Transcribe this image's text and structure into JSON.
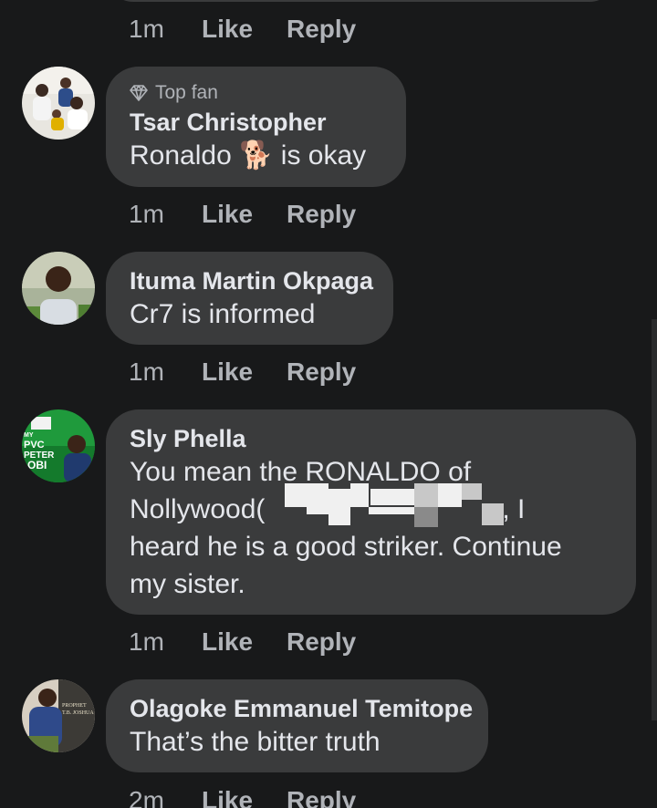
{
  "actions_common": {
    "like": "Like",
    "reply": "Reply"
  },
  "top_actions": {
    "time": "1m"
  },
  "comments": [
    {
      "badge": "Top fan",
      "author": "Tsar Christopher",
      "text_before": "Ronaldo ",
      "emoji": "🐕",
      "text_after": " is okay",
      "time": "1m"
    },
    {
      "author": "Ituma Martin Okpaga",
      "text": "Cr7 is informed",
      "time": "1m"
    },
    {
      "author": "Sly Phella",
      "lines": [
        "You mean the RONALDO of",
        "Nollywood(",
        ", I",
        "heard he is a good striker. Continue",
        "my sister."
      ],
      "time": "1m"
    },
    {
      "author": "Olagoke Emmanuel Temitope",
      "text": "That’s the bitter truth",
      "time": "2m"
    }
  ],
  "avatar_texts": {
    "pvc": [
      "MY",
      "PVC",
      "PETER",
      "OBI"
    ],
    "prophet": [
      "PROPHET",
      "T.B. JOSHUA"
    ]
  },
  "colors": {
    "background": "#18191a",
    "bubble": "#3a3b3c",
    "primary_text": "#e4e6eb",
    "secondary_text": "#b0b3b8",
    "avatar_green": "#1f9a3c"
  },
  "icons": {
    "badge": "diamond-icon"
  }
}
